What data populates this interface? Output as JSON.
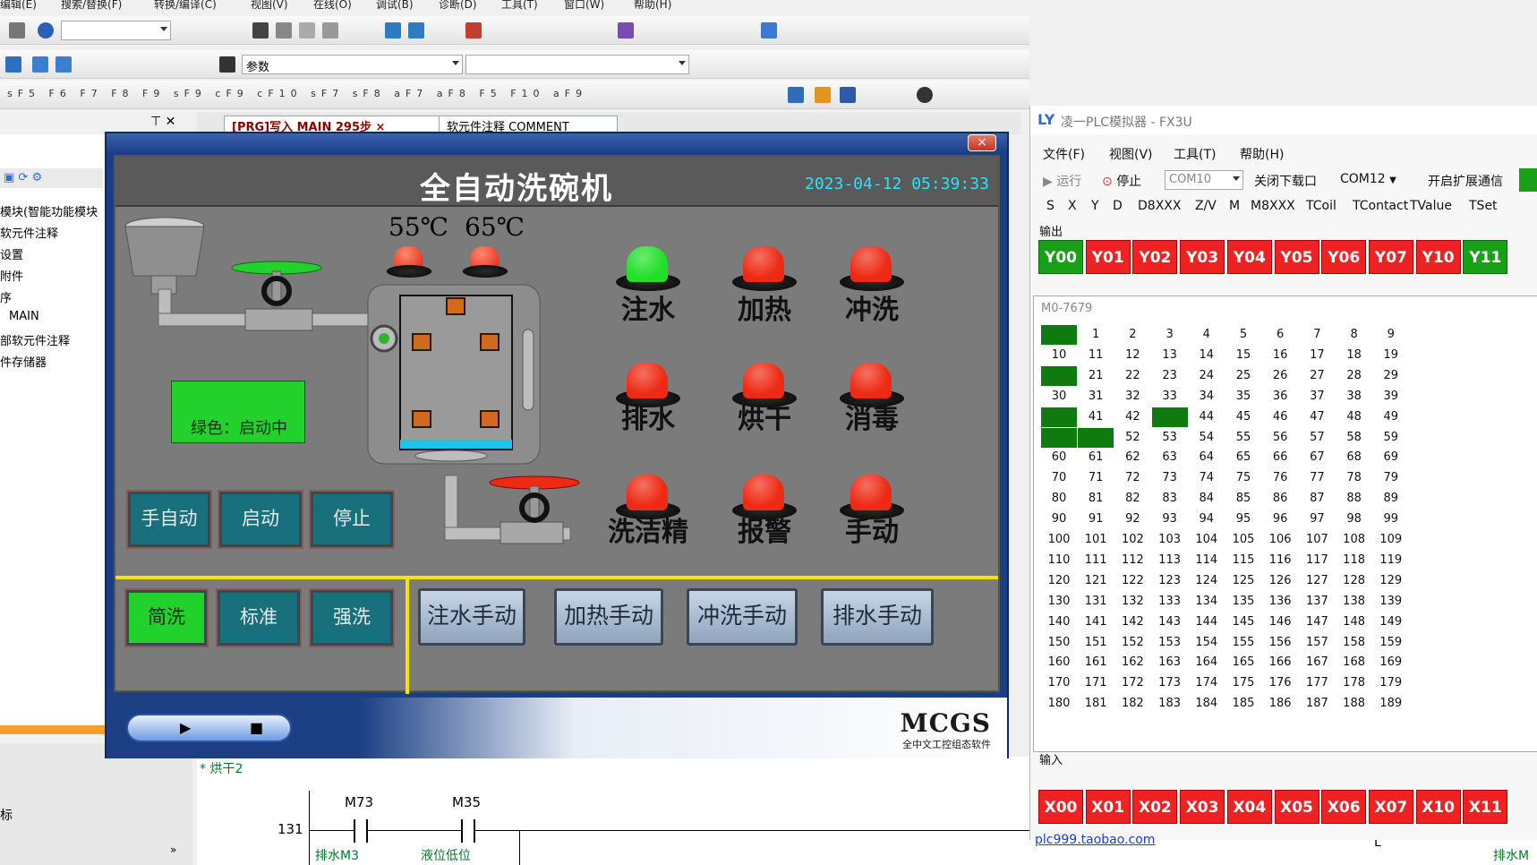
{
  "ide": {
    "menu": [
      "编辑(E)",
      "搜索/替换(F)",
      "转换/编译(C)",
      "视图(V)",
      "在线(O)",
      "调试(B)",
      "诊断(D)",
      "工具(T)",
      "窗口(W)",
      "帮助(H)"
    ],
    "param_combo": "参数",
    "doc_tabs": [
      "[PRG]写入 MAIN 295步",
      "软元件注释 COMMENT"
    ],
    "tree_items": [
      "模块(智能功能模块",
      "软元件注释",
      "设置",
      "附件",
      "序",
      "MAIN",
      "部软元件注释",
      "件存储器"
    ],
    "bottom_left": "标",
    "ladder": {
      "comment": "* 烘干2",
      "step": "131",
      "contacts": [
        {
          "device": "M73",
          "comment": "排水M3"
        },
        {
          "device": "M35",
          "comment": "液位低位"
        }
      ],
      "right_comment": "排水M",
      "right_mark": "L"
    }
  },
  "hmi": {
    "title": "全自动洗碗机",
    "datetime": "2023-04-12 05:39:33",
    "temps": [
      "55℃",
      "65℃"
    ],
    "status": "绿色：启动中",
    "lamps": [
      {
        "label": "注水",
        "color": "#22e02a"
      },
      {
        "label": "加热",
        "color": "#ee2a14"
      },
      {
        "label": "冲洗",
        "color": "#ee2a14"
      },
      {
        "label": "排水",
        "color": "#ee2a14"
      },
      {
        "label": "烘干",
        "color": "#ee2a14"
      },
      {
        "label": "消毒",
        "color": "#ee2a14"
      },
      {
        "label": "洗洁精",
        "color": "#ee2a14"
      },
      {
        "label": "报警",
        "color": "#ee2a14"
      },
      {
        "label": "手动",
        "color": "#ee2a14"
      }
    ],
    "control_buttons": [
      "手自动",
      "启动",
      "停止"
    ],
    "mode_buttons": [
      "简洗",
      "标准",
      "强洗"
    ],
    "manual_buttons": [
      "注水手动",
      "加热手动",
      "冲洗手动",
      "排水手动"
    ],
    "logo": "MCGS",
    "logo_sub": "全中文工控组态软件",
    "close": "×"
  },
  "plc": {
    "logo": "LY",
    "title": "凌一PLC模拟器 - FX3U",
    "menu": [
      "文件(F)",
      "视图(V)",
      "工具(T)",
      "帮助(H)"
    ],
    "run": "运行",
    "stop": "停止",
    "com_a": "COM10",
    "download_off": "关闭下载口",
    "com_b": "COM12",
    "ext_comm": "开启扩展通信",
    "tabs": [
      "S",
      "X",
      "Y",
      "D",
      "D8XXX",
      "Z/V",
      "M",
      "M8XXX",
      "TCoil",
      "TContact",
      "TValue",
      "TSet"
    ],
    "output_label": "输出",
    "outputs": [
      {
        "name": "Y00",
        "on": true
      },
      {
        "name": "Y01",
        "on": false
      },
      {
        "name": "Y02",
        "on": false
      },
      {
        "name": "Y03",
        "on": false
      },
      {
        "name": "Y04",
        "on": false
      },
      {
        "name": "Y05",
        "on": false
      },
      {
        "name": "Y06",
        "on": false
      },
      {
        "name": "Y07",
        "on": false
      },
      {
        "name": "Y10",
        "on": false
      },
      {
        "name": "Y11",
        "on": true
      }
    ],
    "grid_range": "M0-7679",
    "grid_on": [
      0,
      20,
      40,
      43,
      50,
      51
    ],
    "input_label": "输入",
    "inputs": [
      "X00",
      "X01",
      "X02",
      "X03",
      "X04",
      "X05",
      "X06",
      "X07",
      "X10",
      "X11"
    ],
    "link": "plc999.taobao.com"
  },
  "colors": {
    "green_on": "#0f7a0f",
    "io_off": "#ee2222",
    "io_on": "#18a018",
    "hmi_bg": "#7b7b7b",
    "accent_cyan": "#29e2ff"
  }
}
